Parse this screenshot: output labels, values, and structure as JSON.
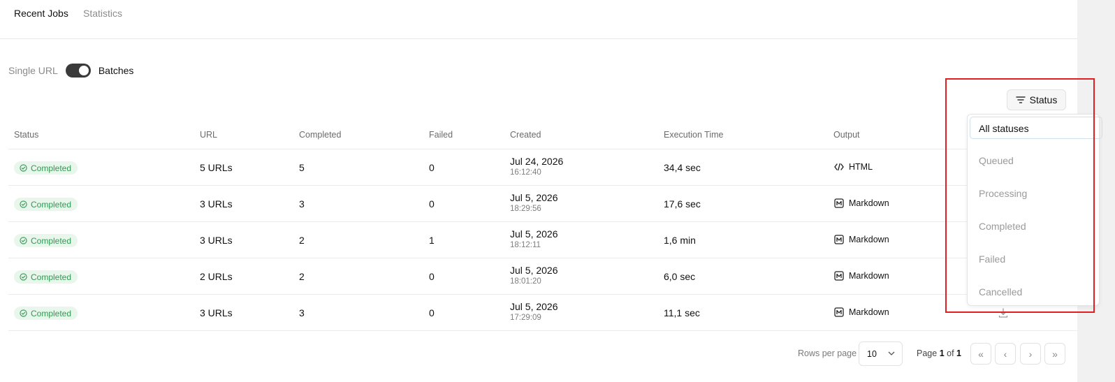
{
  "tabs": [
    {
      "label": "Recent Jobs",
      "active": true
    },
    {
      "label": "Statistics",
      "active": false
    }
  ],
  "mode": {
    "off_label": "Single URL",
    "on_label": "Batches",
    "enabled": true
  },
  "filter": {
    "button_label": "Status"
  },
  "columns": [
    "Status",
    "URL",
    "Completed",
    "Failed",
    "Created",
    "Execution Time",
    "Output"
  ],
  "rows": [
    {
      "status": "Completed",
      "url": "5 URLs",
      "completed": "5",
      "failed": "0",
      "date": "Jul 24, 2026",
      "time": "16:12:40",
      "exec": "34,4 sec",
      "output": "HTML",
      "output_icon": "code-icon"
    },
    {
      "status": "Completed",
      "url": "3 URLs",
      "completed": "3",
      "failed": "0",
      "date": "Jul 5, 2026",
      "time": "18:29:56",
      "exec": "17,6 sec",
      "output": "Markdown",
      "output_icon": "markdown-icon"
    },
    {
      "status": "Completed",
      "url": "3 URLs",
      "completed": "2",
      "failed": "1",
      "date": "Jul 5, 2026",
      "time": "18:12:11",
      "exec": "1,6 min",
      "output": "Markdown",
      "output_icon": "markdown-icon"
    },
    {
      "status": "Completed",
      "url": "2 URLs",
      "completed": "2",
      "failed": "0",
      "date": "Jul 5, 2026",
      "time": "18:01:20",
      "exec": "6,0 sec",
      "output": "Markdown",
      "output_icon": "markdown-icon"
    },
    {
      "status": "Completed",
      "url": "3 URLs",
      "completed": "3",
      "failed": "0",
      "date": "Jul 5, 2026",
      "time": "17:29:09",
      "exec": "11,1 sec",
      "output": "Markdown",
      "output_icon": "markdown-icon"
    }
  ],
  "dropdown": {
    "selected": "All statuses",
    "options": [
      "Queued",
      "Processing",
      "Completed",
      "Failed",
      "Cancelled"
    ]
  },
  "pagination": {
    "rows_per_page_label": "Rows per page",
    "rows_per_page": "10",
    "page_word": "Page",
    "current": "1",
    "of_word": "of",
    "total": "1",
    "first": "«",
    "prev": "‹",
    "next": "›",
    "last": "»"
  },
  "colors": {
    "badge_bg": "#e8f6ec",
    "badge_text": "#2f9a52",
    "highlight": "#e02020",
    "toggle": "#3a3a3a"
  }
}
